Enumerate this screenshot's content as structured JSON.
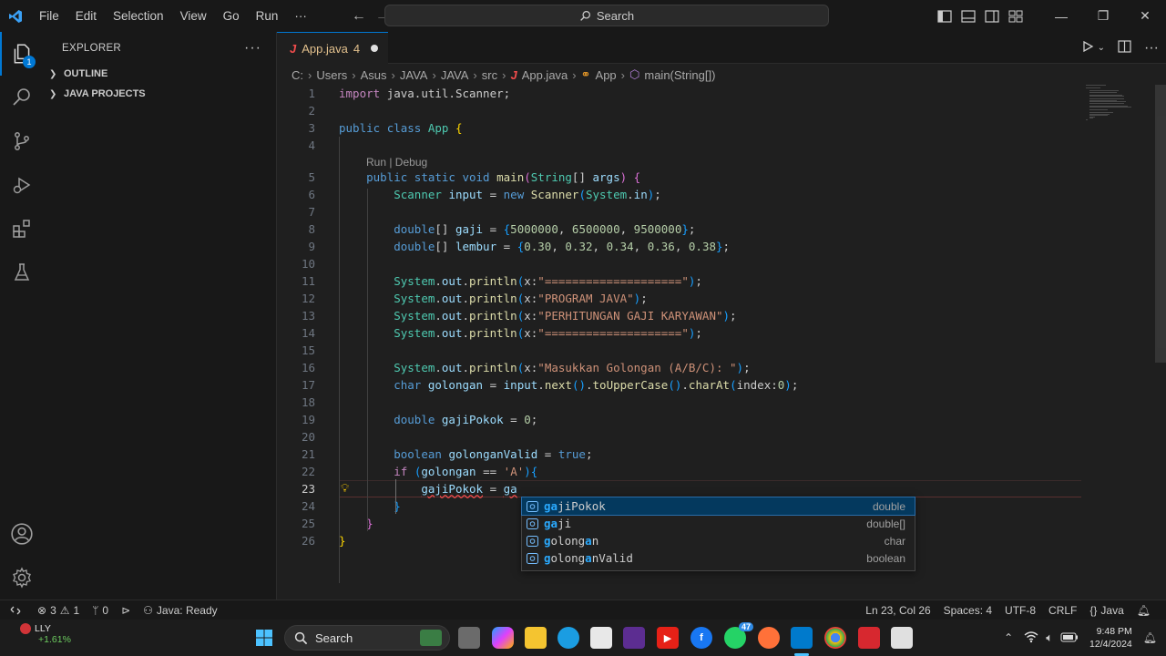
{
  "menu": [
    "File",
    "Edit",
    "Selection",
    "View",
    "Go",
    "Run",
    "···"
  ],
  "search": {
    "label": "Search"
  },
  "activity_badge": "1",
  "sidebar": {
    "title": "EXPLORER",
    "sections": [
      "OUTLINE",
      "JAVA PROJECTS"
    ]
  },
  "tab": {
    "icon": "J",
    "name": "App.java",
    "count": "4"
  },
  "breadcrumb": [
    "C:",
    "Users",
    "Asus",
    "JAVA",
    "JAVA",
    "src",
    "App.java",
    "App",
    "main(String[])"
  ],
  "codelens": "Run | Debug",
  "code_lines": [
    {
      "n": "1",
      "html": "<span class=\"kc\">import</span> <span class=\"h\">java.util.Scanner;</span>"
    },
    {
      "n": "2",
      "html": ""
    },
    {
      "n": "3",
      "html": "<span class=\"k\">public</span> <span class=\"k\">class</span> <span class=\"t\">App</span> <span class=\"brk\">{</span>"
    },
    {
      "n": "4",
      "html": ""
    },
    {
      "n": "5",
      "html": "    <span class=\"k\">public</span> <span class=\"k\">static</span> <span class=\"k\">void</span> <span class=\"f\">main</span><span class=\"brk2\">(</span><span class=\"t\">String</span>[] <span class=\"v\">args</span><span class=\"brk2\">)</span> <span class=\"brk2\">{</span>"
    },
    {
      "n": "6",
      "html": "        <span class=\"t\">Scanner</span> <span class=\"v\">input</span> = <span class=\"k\">new</span> <span class=\"f\">Scanner</span><span class=\"brk3\">(</span><span class=\"t\">System</span>.<span class=\"v\">in</span><span class=\"brk3\">)</span>;"
    },
    {
      "n": "7",
      "html": ""
    },
    {
      "n": "8",
      "html": "        <span class=\"k\">double</span>[] <span class=\"v\">gaji</span> = <span class=\"brk3\">{</span><span class=\"n\">5000000</span>, <span class=\"n\">6500000</span>, <span class=\"n\">9500000</span><span class=\"brk3\">}</span>;"
    },
    {
      "n": "9",
      "html": "        <span class=\"k\">double</span>[] <span class=\"v\">lembur</span> = <span class=\"brk3\">{</span><span class=\"n\">0.30</span>, <span class=\"n\">0.32</span>, <span class=\"n\">0.34</span>, <span class=\"n\">0.36</span>, <span class=\"n\">0.38</span><span class=\"brk3\">}</span>;"
    },
    {
      "n": "10",
      "html": ""
    },
    {
      "n": "11",
      "html": "        <span class=\"t\">System</span>.<span class=\"v\">out</span>.<span class=\"f\">println</span><span class=\"brk3\">(</span>x:<span class=\"s\">\"====================\"</span><span class=\"brk3\">)</span>;"
    },
    {
      "n": "12",
      "html": "        <span class=\"t\">System</span>.<span class=\"v\">out</span>.<span class=\"f\">println</span><span class=\"brk3\">(</span>x:<span class=\"s\">\"PROGRAM JAVA\"</span><span class=\"brk3\">)</span>;"
    },
    {
      "n": "13",
      "html": "        <span class=\"t\">System</span>.<span class=\"v\">out</span>.<span class=\"f\">println</span><span class=\"brk3\">(</span>x:<span class=\"s\">\"PERHITUNGAN GAJI KARYAWAN\"</span><span class=\"brk3\">)</span>;"
    },
    {
      "n": "14",
      "html": "        <span class=\"t\">System</span>.<span class=\"v\">out</span>.<span class=\"f\">println</span><span class=\"brk3\">(</span>x:<span class=\"s\">\"====================\"</span><span class=\"brk3\">)</span>;"
    },
    {
      "n": "15",
      "html": ""
    },
    {
      "n": "16",
      "html": "        <span class=\"t\">System</span>.<span class=\"v\">out</span>.<span class=\"f\">println</span><span class=\"brk3\">(</span>x:<span class=\"s\">\"Masukkan Golongan (A/B/C): \"</span><span class=\"brk3\">)</span>;"
    },
    {
      "n": "17",
      "html": "        <span class=\"k\">char</span> <span class=\"v\">golongan</span> = <span class=\"v\">input</span>.<span class=\"f\">next</span><span class=\"brk3\">()</span>.<span class=\"f\">toUpperCase</span><span class=\"brk3\">()</span>.<span class=\"f\">charAt</span><span class=\"brk3\">(</span>index:<span class=\"n\">0</span><span class=\"brk3\">)</span>;"
    },
    {
      "n": "18",
      "html": ""
    },
    {
      "n": "19",
      "html": "        <span class=\"k\">double</span> <span class=\"v\">gajiPokok</span> = <span class=\"n\">0</span>;"
    },
    {
      "n": "20",
      "html": ""
    },
    {
      "n": "21",
      "html": "        <span class=\"k\">boolean</span> <span class=\"v\">golonganValid</span> = <span class=\"k\">true</span>;"
    },
    {
      "n": "22",
      "html": "        <span class=\"kc\">if</span> <span class=\"brk3\">(</span><span class=\"v\">golongan</span> == <span class=\"s\">'A'</span><span class=\"brk3\">)</span><span class=\"brk3\">{</span>"
    },
    {
      "n": "23",
      "html": "            <span class=\"v squig\">gajiPokok</span> = <span class=\"v squig\">ga</span>"
    },
    {
      "n": "24",
      "html": "        <span class=\"brk3\">}</span>"
    },
    {
      "n": "25",
      "html": "    <span class=\"brk2\">}</span>"
    },
    {
      "n": "26",
      "html": "<span class=\"brk\">}</span>"
    }
  ],
  "suggestions": [
    {
      "prefix": "ga",
      "rest": "jiPokok",
      "type": "double"
    },
    {
      "prefix": "ga",
      "rest": "ji",
      "type": "double[]"
    },
    {
      "prefix": "g",
      "rest": "olong",
      "mid": "a",
      "tail": "n",
      "type": "char"
    },
    {
      "prefix": "g",
      "rest": "olong",
      "mid": "a",
      "tail": "nValid",
      "type": "boolean"
    }
  ],
  "status": {
    "errors": "3",
    "warnings": "1",
    "ports": "0",
    "java": "Java: Ready",
    "position": "Ln 23, Col 26",
    "spaces": "Spaces: 4",
    "encoding": "UTF-8",
    "eol": "CRLF",
    "language": "Java"
  },
  "taskbar": {
    "weather_name": "LLY",
    "weather_change": "+1.61%",
    "search": "Search",
    "badge": "47",
    "time": "9:48 PM",
    "date": "12/4/2024"
  },
  "colors": {
    "accent": "#0078d4",
    "background": "#1f1f1f",
    "sidebar": "#181818"
  }
}
